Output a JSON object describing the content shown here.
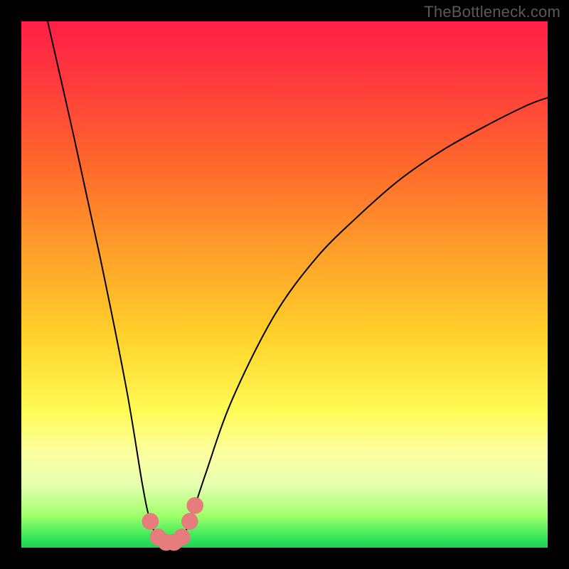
{
  "watermark": "TheBottleneck.com",
  "chart_data": {
    "type": "line",
    "title": "",
    "xlabel": "",
    "ylabel": "",
    "xlim": [
      0,
      100
    ],
    "ylim": [
      0,
      100
    ],
    "grid": false,
    "legend": false,
    "series": [
      {
        "name": "bottleneck-curve",
        "stroke": "#000000",
        "x": [
          5,
          10,
          15,
          20,
          23,
          24.5,
          26,
          27.5,
          29,
          30.5,
          32,
          35,
          40,
          48,
          56,
          64,
          72,
          80,
          88,
          96,
          100
        ],
        "y": [
          100,
          78,
          55,
          30,
          12,
          5,
          2,
          1,
          1,
          2,
          5,
          14,
          28,
          44,
          55,
          63,
          70,
          75.5,
          80,
          84,
          85.5
        ]
      }
    ],
    "markers": {
      "name": "highlight-dots",
      "color": "#e77c7c",
      "radius": 1.6,
      "points": [
        {
          "x": 24.5,
          "y": 5
        },
        {
          "x": 26,
          "y": 2
        },
        {
          "x": 27.5,
          "y": 1
        },
        {
          "x": 29,
          "y": 1
        },
        {
          "x": 30.5,
          "y": 2
        },
        {
          "x": 32,
          "y": 5
        },
        {
          "x": 33,
          "y": 8
        }
      ]
    }
  }
}
